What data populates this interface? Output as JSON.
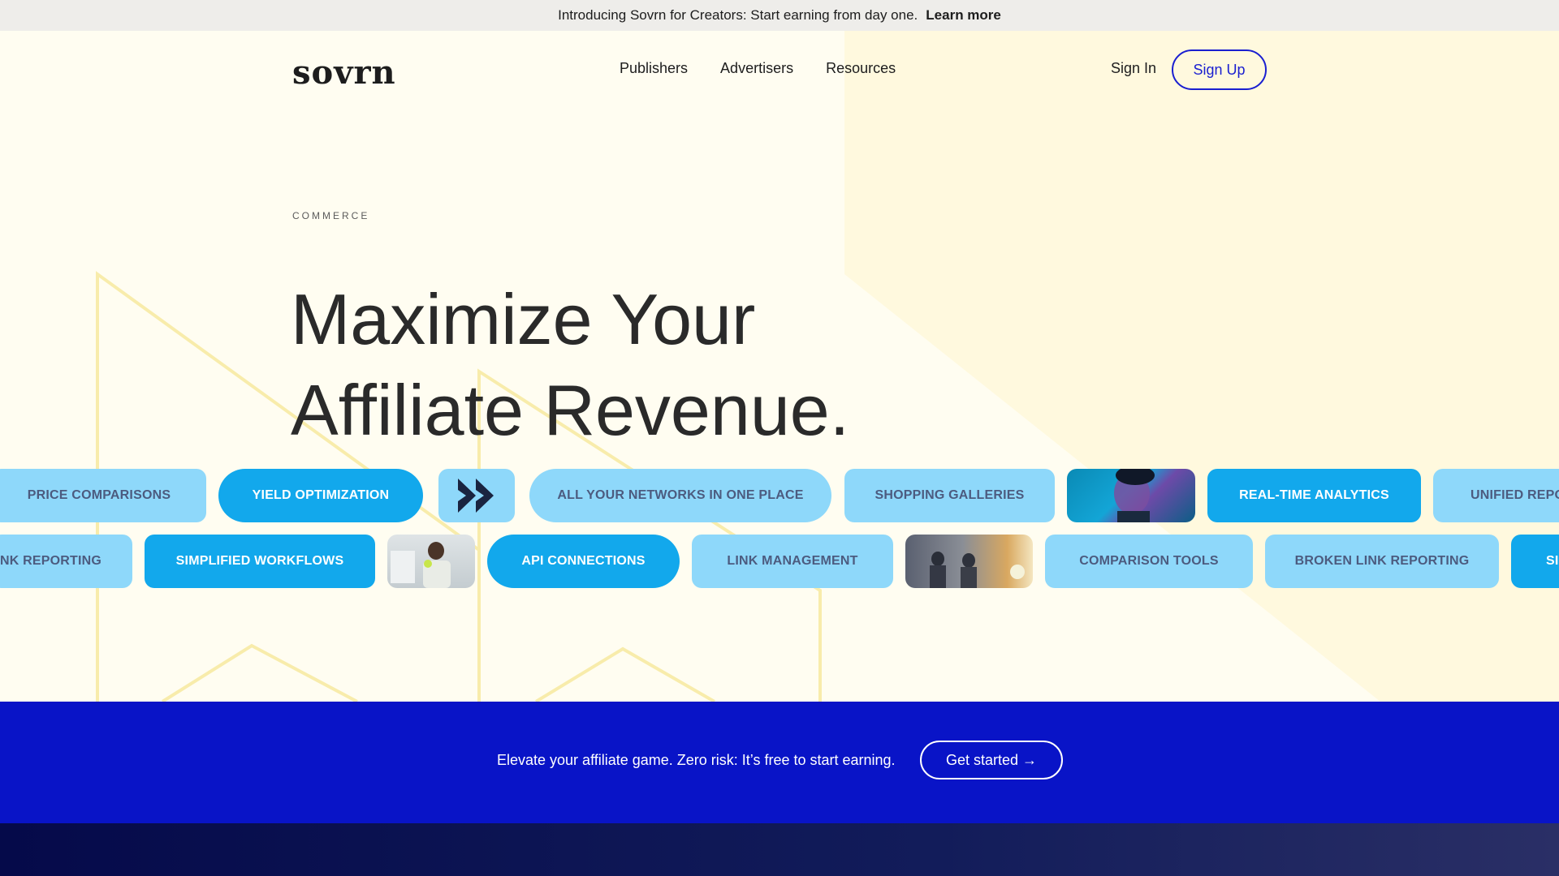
{
  "announcement": {
    "text": "Introducing Sovrn for Creators: Start earning from day one.",
    "link": "Learn more"
  },
  "header": {
    "logo": "sovrn",
    "nav": [
      "Publishers",
      "Advertisers",
      "Resources"
    ],
    "sign_in": "Sign In",
    "sign_up": "Sign Up"
  },
  "hero": {
    "eyebrow": "COMMERCE",
    "headline_line1": "Maximize Your",
    "headline_line2": "Affiliate Revenue."
  },
  "features": {
    "row1": [
      {
        "label": "PRICE COMPARISONS"
      },
      {
        "label": "YIELD OPTIMIZATION"
      },
      {
        "icon": "sovrn-chevrons-icon"
      },
      {
        "label": "ALL YOUR NETWORKS IN ONE PLACE"
      },
      {
        "label": "SHOPPING GALLERIES"
      },
      {
        "image": "person-portrait-image"
      },
      {
        "label": "REAL-TIME ANALYTICS"
      },
      {
        "label": "UNIFIED REPO"
      }
    ],
    "row2": [
      {
        "label": "NK REPORTING"
      },
      {
        "label": "SIMPLIFIED WORKFLOWS"
      },
      {
        "image": "person-on-call-image"
      },
      {
        "label": "API CONNECTIONS"
      },
      {
        "label": "LINK MANAGEMENT"
      },
      {
        "image": "office-meeting-image"
      },
      {
        "label": "COMPARISON TOOLS"
      },
      {
        "label": "BROKEN LINK REPORTING"
      },
      {
        "label": "SI"
      }
    ]
  },
  "cta": {
    "text": "Elevate your affiliate game. Zero risk: It’s free to start earning.",
    "button": "Get started →"
  },
  "colors": {
    "accent_blue": "#0914c7",
    "pill_dark": "#12a8ec",
    "pill_light": "#8ed8fa",
    "background": "#fffdf1"
  }
}
